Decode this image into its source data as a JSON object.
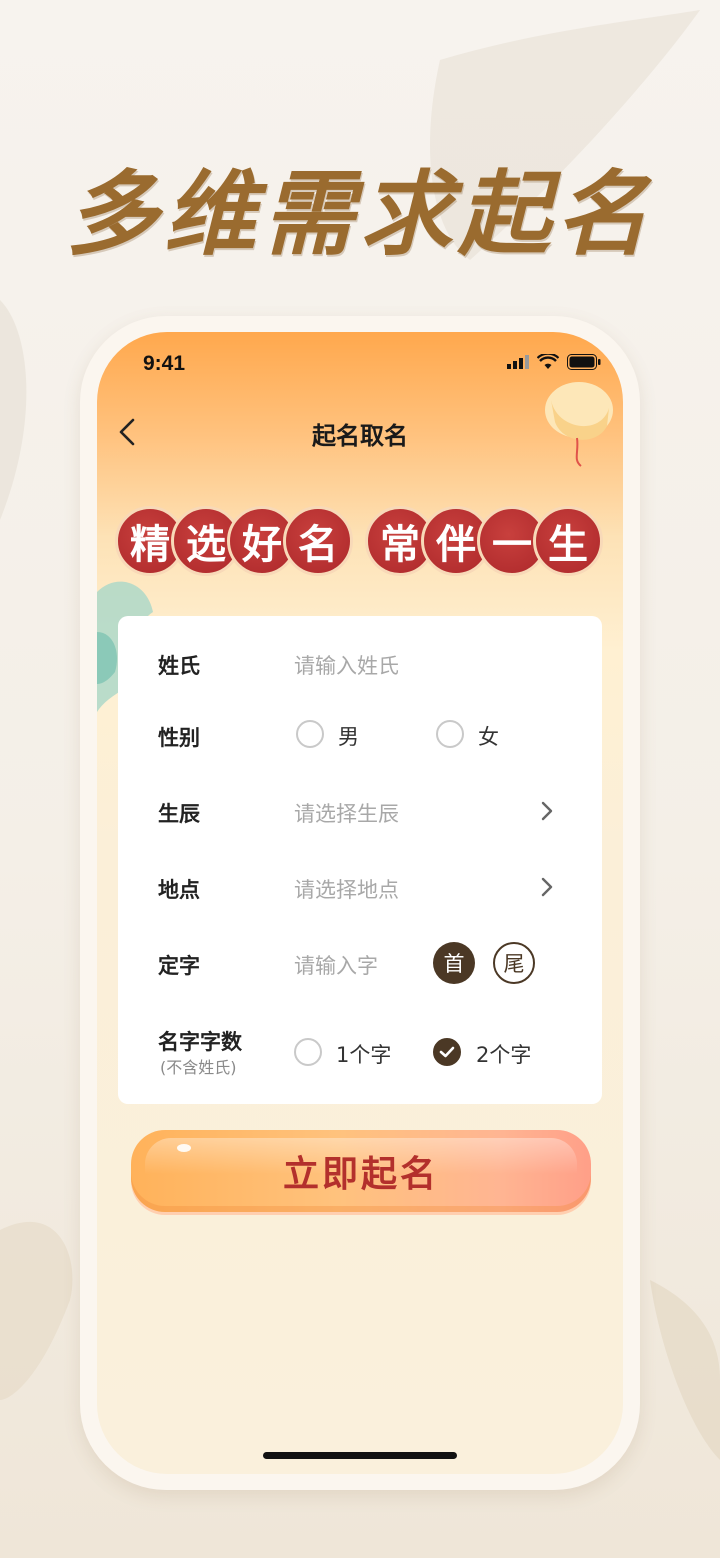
{
  "headline": "多维需求起名",
  "status_bar": {
    "time": "9:41"
  },
  "nav": {
    "title": "起名取名",
    "back_icon": "chevron-left-icon"
  },
  "banner": {
    "left": [
      "精",
      "选",
      "好",
      "名"
    ],
    "right": [
      "常",
      "伴",
      "一",
      "生"
    ]
  },
  "form": {
    "surname": {
      "label": "姓氏",
      "placeholder": "请输入姓氏"
    },
    "gender": {
      "label": "性别",
      "options": [
        "男",
        "女"
      ],
      "selected": null
    },
    "birth": {
      "label": "生辰",
      "placeholder": "请选择生辰"
    },
    "place": {
      "label": "地点",
      "placeholder": "请选择地点"
    },
    "fixed_char": {
      "label": "定字",
      "placeholder": "请输入字",
      "positions": [
        "首",
        "尾"
      ],
      "selected_position": "首"
    },
    "name_length": {
      "label": "名字字数",
      "sublabel": "(不含姓氏)",
      "options": [
        "1个字",
        "2个字"
      ],
      "selected": "2个字"
    }
  },
  "cta": {
    "label": "立即起名"
  },
  "colors": {
    "accent": "#4b3825",
    "banner_red": "#b52f30",
    "headline": "#9a6b2f",
    "cta_text": "#b3302c"
  }
}
